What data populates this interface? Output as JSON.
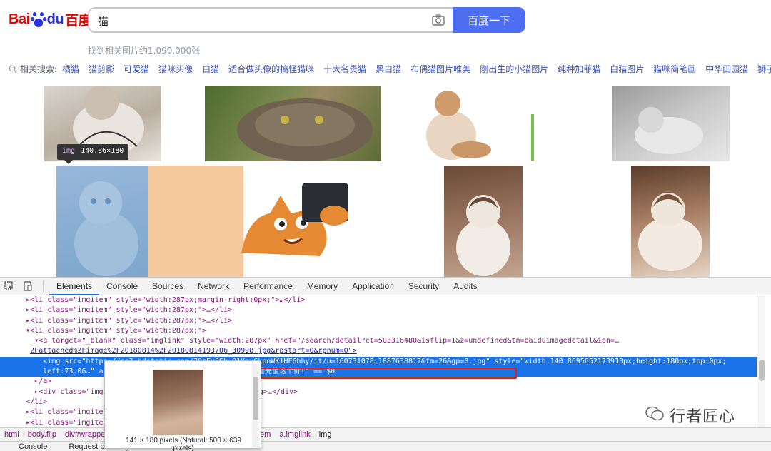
{
  "search": {
    "logo_text_1": "Bai",
    "logo_text_2": "du",
    "logo_text_3": "百度",
    "query": "猫",
    "button_label": "百度一下",
    "result_count": "找到相关图片约1,090,000张"
  },
  "related": {
    "label": "相关搜索:",
    "items": [
      "橘猫",
      "猫剪影",
      "可爱猫",
      "猫咪头像",
      "白猫",
      "适合做头像的搞怪猫咪",
      "十大名贵猫",
      "黑白猫",
      "布偶猫图片唯美",
      "刚出生的小猫图片",
      "纯种加菲猫",
      "白猫图片",
      "猫咪简笔画",
      "中华田园猫",
      "狮子猫"
    ]
  },
  "tooltip": {
    "tag": "img",
    "size": "140.86×180"
  },
  "devtools": {
    "tabs": [
      "Elements",
      "Console",
      "Sources",
      "Network",
      "Performance",
      "Memory",
      "Application",
      "Security",
      "Audits"
    ],
    "active_tab": "Elements",
    "code_lines": [
      {
        "indent": "      ",
        "text": "▸<li class=\"imgitem\" style=\"width:287px;margin-right:0px;\">…</li>"
      },
      {
        "indent": "      ",
        "text": "▸<li class=\"imgitem\" style=\"width:287px;\">…</li>"
      },
      {
        "indent": "      ",
        "text": "▸<li class=\"imgitem\" style=\"width:287px;\">…</li>"
      },
      {
        "indent": "      ",
        "text": "▾<li class=\"imgitem\" style=\"width:287px;\">"
      },
      {
        "indent": "        ",
        "text": "▾<a target=\"_blank\" class=\"imglink\" style=\"width:287px\" href=\"/search/detail?ct=503316480&isflip=1&z=undefined&tn=baiduimagedetail&ipn=…"
      },
      {
        "indent": "       ",
        "text": "2Fattached%2Fimage%2F20180814%2F20180814193706_30998.jpg&rpstart=0&rpnum=0\">"
      },
      {
        "indent": "          ",
        "text": "<img src=\"https://ss3.bdstatic.com/70cFv8Sh_Q1YnxGkpoWK1HF6hhy/it/u=160731078,1887638817&fm=26&gp=0.jpg\" style=\"width:140.8695652173913px;height:180px;top:0px;"
      },
      {
        "indent": "          ",
        "text": "left:73.06…\" alt=\"…<strong>猫</strong>…\">多少钱一只?看完值这个价!\" == $0"
      },
      {
        "indent": "        ",
        "text": "</a>"
      },
      {
        "indent": "        ",
        "text": "▸<div class=\"imgitem-…\">…多少钱一只?看完值这个价!</strong>…</div>"
      },
      {
        "indent": "      ",
        "text": "</li>"
      },
      {
        "indent": "      ",
        "text": "▸<li class=\"imgitem\" …>…</li>"
      },
      {
        "indent": "      ",
        "text": "▸<li class=\"imgitem\" …margin-right:0px;\">…</li>"
      }
    ],
    "breadcrumb": [
      "html",
      "body.flip",
      "div#wrapper",
      "li.imgitem",
      "a.imglink",
      "img"
    ],
    "drawer_tabs": [
      "Console",
      "Request blocking"
    ],
    "preview_caption": "141 × 180 pixels (Natural: 500 × 639 pixels)"
  },
  "watermark": "行者匠心"
}
